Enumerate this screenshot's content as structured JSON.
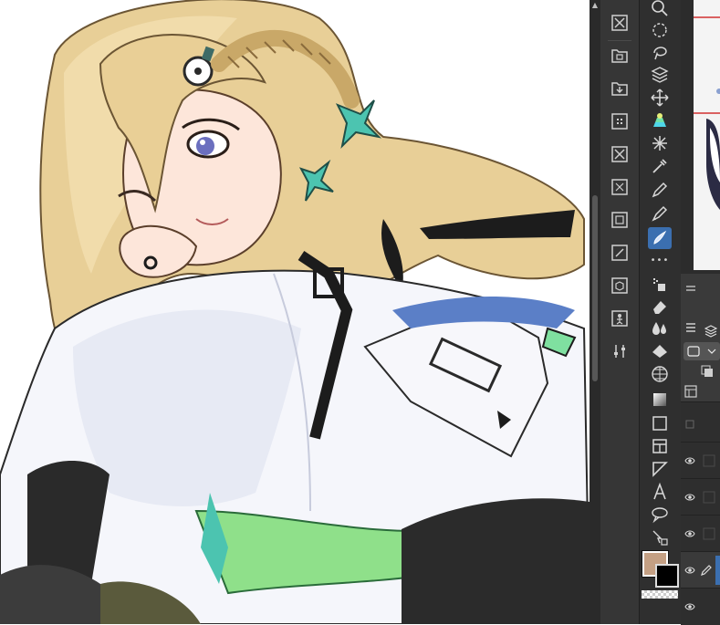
{
  "canvas": {
    "artwork_description_name": "illustration-canvas",
    "bg_color": "#ffffff"
  },
  "command_bar": {
    "buttons": [
      "close-icon",
      "save-icon",
      "import-icon",
      "grid-icon",
      "close-icon",
      "resize-icon",
      "display-icon",
      "edit-icon",
      "object-icon",
      "figure-icon",
      "settings-icon"
    ]
  },
  "tool_bar": {
    "tools": [
      "zoom-icon",
      "lasso-icon",
      "free-select-icon",
      "layer-select-icon",
      "move-icon",
      "fill-icon",
      "magic-wand-icon",
      "eyedropper-icon",
      "pen-icon",
      "pencil-icon",
      "brush-icon",
      "more-dots-icon",
      "airbrush-icon",
      "eraser-icon",
      "blend-icon",
      "fill-bucket-icon",
      "grid-tool-icon",
      "gradient-icon",
      "rectangle-icon",
      "frame-icon",
      "ruler-icon",
      "text-icon",
      "speech-balloon-icon",
      "correct-line-icon"
    ],
    "active_tool": "brush-icon",
    "main_color": "#c4a084",
    "sub_color": "#000000"
  },
  "right_panel": {
    "layer_rows": 5
  }
}
